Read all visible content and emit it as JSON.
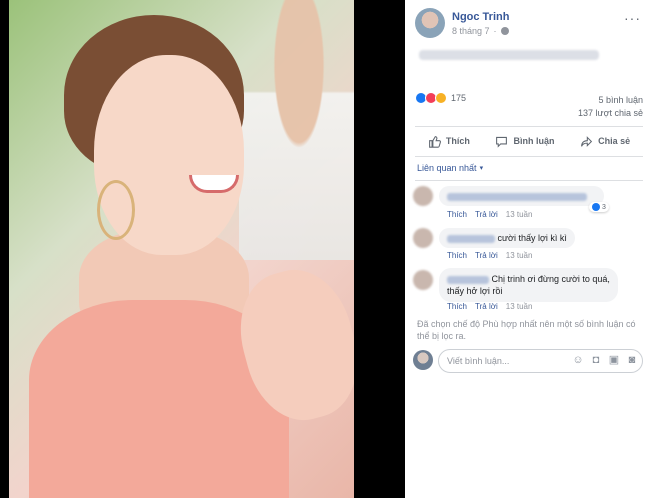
{
  "post": {
    "author_name": "Ngoc Trinh",
    "date": "8 tháng 7",
    "menu_icon": "···"
  },
  "stats": {
    "reaction_icons": [
      "like-icon",
      "love-icon",
      "wow-icon"
    ],
    "reaction_count": "175",
    "comments": "5 bình luận",
    "shares": "137 lượt chia sẻ"
  },
  "actions": {
    "like": "Thích",
    "comment": "Bình luận",
    "share": "Chia sẻ"
  },
  "sort": {
    "label": "Liên quan nhất",
    "caret": "▾"
  },
  "comments": [
    {
      "text": "",
      "reply": "Trả lời",
      "like": "Thích",
      "time": "13 tuần",
      "like_count": "3"
    },
    {
      "text": "cười thấy lợi kì kì",
      "reply": "Trả lời",
      "like": "Thích",
      "time": "13 tuần"
    },
    {
      "text_line1": "Chị trinh ơi đừng cười to quá,",
      "text_line2": "thấy hở lợi rồi",
      "reply": "Trả lời",
      "like": "Thích",
      "time": "13 tuần"
    }
  ],
  "filter_note": "Đã chọn chế độ Phù hợp nhất nên một số bình luận có thể bị lọc ra.",
  "composer": {
    "placeholder": "Viết bình luận...",
    "icons": [
      "emoji-icon",
      "camera-icon",
      "gif-icon",
      "sticker-icon"
    ]
  },
  "colors": {
    "link": "#385898",
    "meta": "#90949c",
    "like_blue": "#1877f2",
    "love_red": "#f33e58",
    "wow_yellow": "#f7b125"
  }
}
